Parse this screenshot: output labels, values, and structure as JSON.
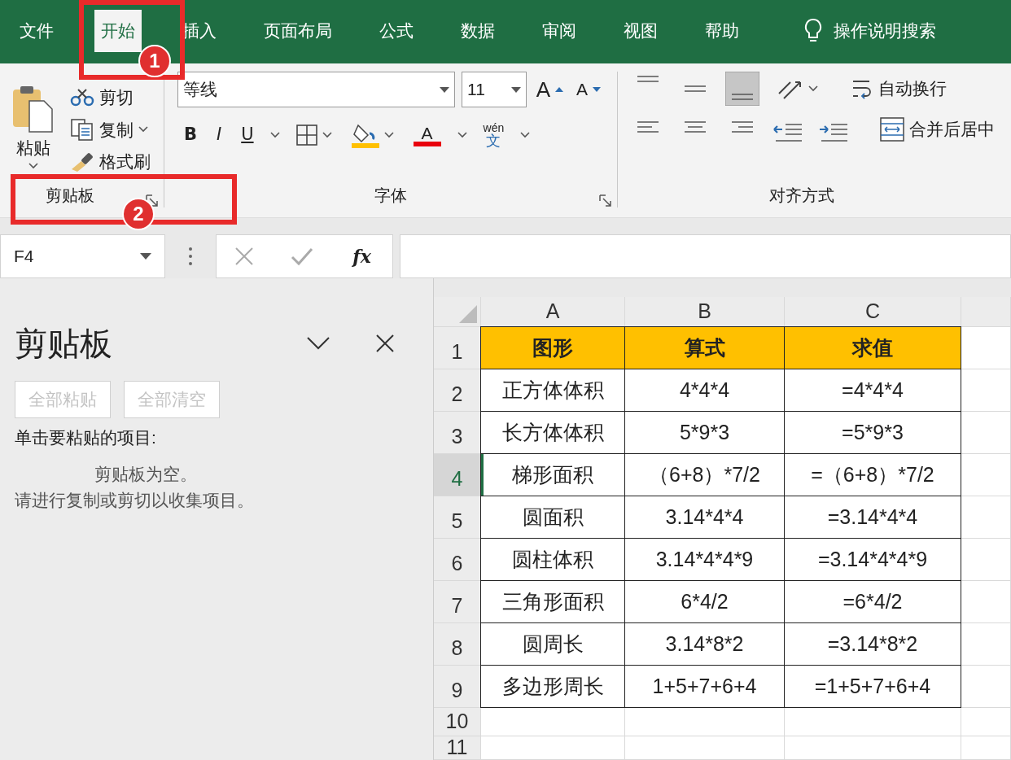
{
  "menu_tabs": [
    {
      "label": "文件",
      "selected": false
    },
    {
      "label": "开始",
      "selected": true
    },
    {
      "label": "插入",
      "selected": false
    },
    {
      "label": "页面布局",
      "selected": false
    },
    {
      "label": "公式",
      "selected": false
    },
    {
      "label": "数据",
      "selected": false
    },
    {
      "label": "审阅",
      "selected": false
    },
    {
      "label": "视图",
      "selected": false
    },
    {
      "label": "帮助",
      "selected": false
    }
  ],
  "tell_me": "操作说明搜索",
  "ribbon": {
    "clipboard": {
      "paste": "粘贴",
      "cut": "剪切",
      "copy": "复制",
      "format_painter": "格式刷",
      "group_label": "剪贴板"
    },
    "font": {
      "font_name": "等线",
      "font_size": "11",
      "grow_glyph": "A",
      "shrink_glyph": "A",
      "format_buttons": [
        "B",
        "I",
        "U"
      ],
      "font_color_glyph": "A",
      "phonetic_top": "wén",
      "phonetic_bottom": "文",
      "group_label": "字体"
    },
    "alignment": {
      "wrap_text": "自动换行",
      "merge_center": "合并后居中",
      "group_label": "对齐方式"
    }
  },
  "formula_bar": {
    "name_box": "F4",
    "function_glyph": "fx"
  },
  "clipboard_pane": {
    "title": "剪贴板",
    "buttons": [
      {
        "label": "全部粘贴",
        "disabled": true
      },
      {
        "label": "全部清空",
        "disabled": true
      }
    ],
    "instruction": "单击要粘贴的项目:",
    "empty_lines": [
      "剪贴板为空。",
      "请进行复制或剪切以收集项目。"
    ]
  },
  "sheet": {
    "columns": [
      "A",
      "B",
      "C"
    ],
    "rows": [
      {
        "number": "1",
        "kind": "header",
        "selected": false,
        "cells": [
          "图形",
          "算式",
          "求值"
        ]
      },
      {
        "number": "2",
        "kind": "data",
        "selected": false,
        "cells": [
          "正方体体积",
          "4*4*4",
          "=4*4*4"
        ]
      },
      {
        "number": "3",
        "kind": "data",
        "selected": false,
        "cells": [
          "长方体体积",
          "5*9*3",
          "=5*9*3"
        ]
      },
      {
        "number": "4",
        "kind": "data",
        "selected": true,
        "cells": [
          "梯形面积",
          "（6+8）*7/2",
          "=（6+8）*7/2"
        ]
      },
      {
        "number": "5",
        "kind": "data",
        "selected": false,
        "cells": [
          "圆面积",
          "3.14*4*4",
          "=3.14*4*4"
        ]
      },
      {
        "number": "6",
        "kind": "data",
        "selected": false,
        "cells": [
          "圆柱体积",
          "3.14*4*4*9",
          "=3.14*4*4*9"
        ]
      },
      {
        "number": "7",
        "kind": "data",
        "selected": false,
        "cells": [
          "三角形面积",
          "6*4/2",
          "=6*4/2"
        ]
      },
      {
        "number": "8",
        "kind": "data",
        "selected": false,
        "cells": [
          "圆周长",
          "3.14*8*2",
          "=3.14*8*2"
        ]
      },
      {
        "number": "9",
        "kind": "data",
        "selected": false,
        "cells": [
          "多边形周长",
          "1+5+7+6+4",
          "=1+5+7+6+4"
        ]
      },
      {
        "number": "10",
        "kind": "empty",
        "selected": false,
        "cells": []
      },
      {
        "number": "11",
        "kind": "empty",
        "selected": false,
        "cells": []
      }
    ]
  },
  "callouts": [
    {
      "number": "1"
    },
    {
      "number": "2"
    }
  ]
}
